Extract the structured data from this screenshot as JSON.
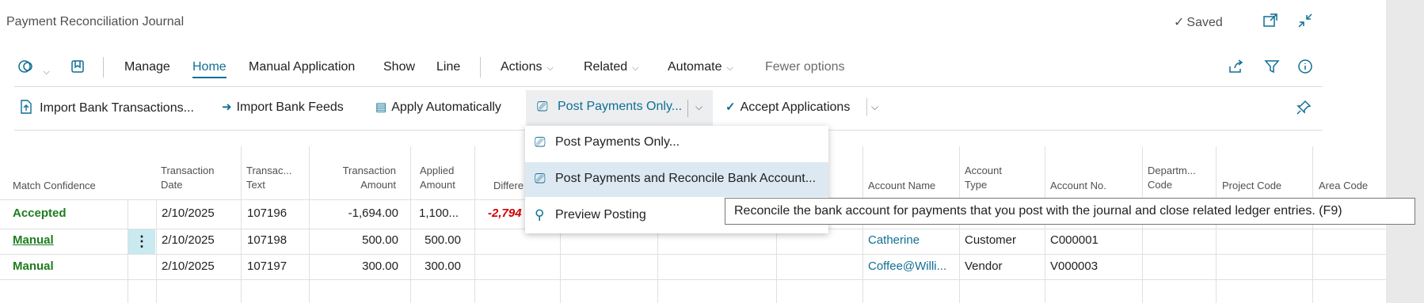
{
  "window": {
    "title": "Payment Reconciliation Journal",
    "status": "Saved"
  },
  "menu": {
    "items": [
      "Manage",
      "Home",
      "Manual Application",
      "Show",
      "Line"
    ],
    "active": "Home",
    "dropdowns": [
      "Actions",
      "Related",
      "Automate"
    ],
    "fewer_options": "Fewer options"
  },
  "actions": {
    "import_bank_transactions": "Import Bank Transactions...",
    "import_bank_feeds": "Import Bank Feeds",
    "apply_automatically": "Apply Automatically",
    "post_payments_only": "Post Payments Only...",
    "accept_applications": "Accept Applications"
  },
  "dropdown_menu": {
    "items": [
      "Post Payments Only...",
      "Post Payments and Reconcile Bank Account...",
      "Preview Posting"
    ],
    "highlighted_index": 1
  },
  "tooltip": "Reconcile the bank account for payments that you post with the journal and close related ledger entries. (F9)",
  "grid": {
    "headers": {
      "match_confidence": "Match Confidence",
      "transaction_date": [
        "Transaction",
        "Date"
      ],
      "transaction_text": [
        "Transac...",
        "Text"
      ],
      "transaction_amount": [
        "Transaction",
        "Amount"
      ],
      "applied_amount": [
        "Applied",
        "Amount"
      ],
      "difference": "Differe",
      "account_name": "Account Name",
      "account_type": [
        "Account",
        "Type"
      ],
      "account_no": "Account No.",
      "department_code": [
        "Departm...",
        "Code"
      ],
      "project_code": "Project Code",
      "area_code": "Area Code"
    },
    "rows": [
      {
        "match_confidence": "Accepted",
        "transaction_date": "2/10/2025",
        "transaction_text": "107196",
        "transaction_amount": "-1,694.00",
        "applied_amount": "1,100...",
        "difference": "-2,794",
        "account_name": "",
        "account_type": "",
        "account_no": ""
      },
      {
        "match_confidence": "Manual",
        "transaction_date": "2/10/2025",
        "transaction_text": "107198",
        "transaction_amount": "500.00",
        "applied_amount": "500.00",
        "difference": "",
        "account_name": "Catherine",
        "account_type": "Customer",
        "account_no": "C000001"
      },
      {
        "match_confidence": "Manual",
        "transaction_date": "2/10/2025",
        "transaction_text": "107197",
        "transaction_amount": "300.00",
        "applied_amount": "300.00",
        "difference": "",
        "account_name": "Coffee@Willi...",
        "account_type": "Vendor",
        "account_no": "V000003"
      }
    ]
  },
  "colors": {
    "accent": "#0f6f93",
    "positive": "#1e7d1e",
    "negative": "#d00000",
    "highlight": "#dde9f2"
  },
  "icons": [
    "checkmark-icon",
    "open-new-window-icon",
    "collapse-icon",
    "copilot-icon",
    "bookmark-icon",
    "share-icon",
    "filter-icon",
    "info-icon",
    "pin-icon"
  ]
}
